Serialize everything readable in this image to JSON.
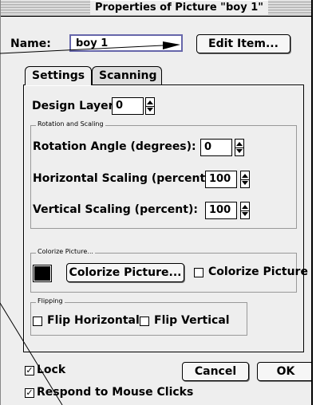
{
  "window": {
    "title": "Properties of Picture \"boy 1\""
  },
  "name": {
    "label": "Name:",
    "value": "boy 1"
  },
  "buttons": {
    "edit_item": "Edit Item...",
    "colorize": "Colorize Picture...",
    "cancel": "Cancel",
    "ok": "OK"
  },
  "tabs": [
    {
      "label": "Settings",
      "selected": true
    },
    {
      "label": "Scanning",
      "selected": false
    }
  ],
  "design_layer": {
    "label": "Design Layer",
    "value": "0"
  },
  "rotation_scaling": {
    "group_label": "Rotation and Scaling",
    "rotation_label": "Rotation Angle (degrees):",
    "rotation_value": "0",
    "hscale_label": "Horizontal Scaling (percent):",
    "hscale_value": "100",
    "vscale_label": "Vertical Scaling (percent):",
    "vscale_value": "100"
  },
  "colorize": {
    "group_label": "Colorize Picture...",
    "checkbox_label": "Colorize Picture",
    "checked": false,
    "swatch_color": "#000000"
  },
  "flipping": {
    "group_label": "Flipping",
    "horizontal_label": "Flip Horizontal",
    "horizontal_checked": false,
    "vertical_label": "Flip Vertical",
    "vertical_checked": false
  },
  "lock": {
    "label": "Lock",
    "checked": true
  },
  "respond": {
    "label": "Respond to Mouse Clicks",
    "checked": true
  }
}
